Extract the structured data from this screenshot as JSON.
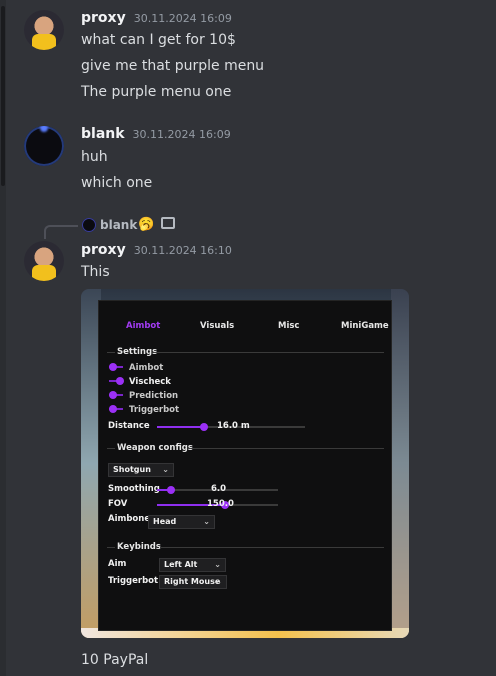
{
  "messages": [
    {
      "author": "proxy",
      "time": "30.11.2024 16:09",
      "lines": [
        "what can I get for 10$",
        "give me that purple menu",
        "The purple menu one"
      ]
    },
    {
      "author": "blank",
      "time": "30.11.2024 16:09",
      "lines": [
        "huh",
        "which one"
      ]
    },
    {
      "reply": {
        "author": "blank",
        "emoji": "🥱"
      },
      "author": "proxy",
      "time": "30.11.2024 16:10",
      "lines": [
        "This"
      ],
      "attachment": {
        "menu": {
          "tabs": [
            "Aimbot",
            "Visuals",
            "Misc",
            "MiniGame"
          ],
          "active_tab": "Aimbot",
          "settings": {
            "title": "Settings",
            "toggles": [
              {
                "label": "Aimbot",
                "on": false
              },
              {
                "label": "Vischeck",
                "on": true
              },
              {
                "label": "Prediction",
                "on": false
              },
              {
                "label": "Triggerbot",
                "on": false
              }
            ],
            "distance": {
              "label": "Distance",
              "value": "16.0 m",
              "fraction": 0.32
            }
          },
          "weapon": {
            "title": "Weapon configs",
            "weapon_select": "Shotgun",
            "smoothing": {
              "label": "Smoothing",
              "value": "6.0",
              "fraction": 0.12
            },
            "fov": {
              "label": "FOV",
              "value": "150.0",
              "fraction": 0.56
            },
            "aimbone": {
              "label": "Aimbone",
              "value": "Head"
            }
          },
          "keybinds": {
            "title": "Keybinds",
            "aim": {
              "label": "Aim",
              "value": "Left Alt"
            },
            "triggerbot": {
              "label": "Triggerbot",
              "value": "Right Mouse"
            }
          }
        }
      },
      "after": "10 PayPal"
    }
  ],
  "colors": {
    "background": "#313338",
    "accent_purple": "#9b30f6",
    "name": "#f2f3f5",
    "timestamp": "#949ba4"
  }
}
